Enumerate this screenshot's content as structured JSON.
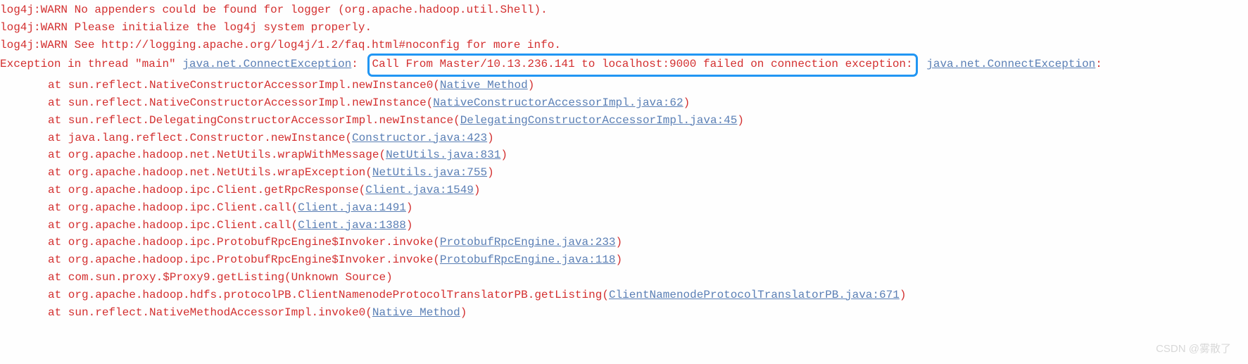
{
  "warn1": "log4j:WARN No appenders could be found for logger (org.apache.hadoop.util.Shell).",
  "warn2": "log4j:WARN Please initialize the log4j system properly.",
  "warn3": "log4j:WARN See http://logging.apache.org/log4j/1.2/faq.html#noconfig for more info.",
  "exception": {
    "prefix": "Exception in thread \"main\" ",
    "class1": "java.net.ConnectException",
    "colon": ": ",
    "highlighted": "Call From Master/10.13.236.141 to localhost:9000 failed on connection exception:",
    "space": " ",
    "class2": "java.net.ConnectException",
    "suffix": ":"
  },
  "stack": [
    {
      "at": "at sun.reflect.NativeConstructorAccessorImpl.newInstance0(",
      "link": "Native Method",
      "close": ")"
    },
    {
      "at": "at sun.reflect.NativeConstructorAccessorImpl.newInstance(",
      "link": "NativeConstructorAccessorImpl.java:62",
      "close": ")"
    },
    {
      "at": "at sun.reflect.DelegatingConstructorAccessorImpl.newInstance(",
      "link": "DelegatingConstructorAccessorImpl.java:45",
      "close": ")"
    },
    {
      "at": "at java.lang.reflect.Constructor.newInstance(",
      "link": "Constructor.java:423",
      "close": ")"
    },
    {
      "at": "at org.apache.hadoop.net.NetUtils.wrapWithMessage(",
      "link": "NetUtils.java:831",
      "close": ")"
    },
    {
      "at": "at org.apache.hadoop.net.NetUtils.wrapException(",
      "link": "NetUtils.java:755",
      "close": ")"
    },
    {
      "at": "at org.apache.hadoop.ipc.Client.getRpcResponse(",
      "link": "Client.java:1549",
      "close": ")"
    },
    {
      "at": "at org.apache.hadoop.ipc.Client.call(",
      "link": "Client.java:1491",
      "close": ")"
    },
    {
      "at": "at org.apache.hadoop.ipc.Client.call(",
      "link": "Client.java:1388",
      "close": ")"
    },
    {
      "at": "at org.apache.hadoop.ipc.ProtobufRpcEngine$Invoker.invoke(",
      "link": "ProtobufRpcEngine.java:233",
      "close": ")"
    },
    {
      "at": "at org.apache.hadoop.ipc.ProtobufRpcEngine$Invoker.invoke(",
      "link": "ProtobufRpcEngine.java:118",
      "close": ")"
    },
    {
      "at": "at com.sun.proxy.$Proxy9.getListing(Unknown Source)",
      "link": "",
      "close": ""
    },
    {
      "at": "at org.apache.hadoop.hdfs.protocolPB.ClientNamenodeProtocolTranslatorPB.getListing(",
      "link": "ClientNamenodeProtocolTranslatorPB.java:671",
      "close": ")"
    },
    {
      "at": "at sun.reflect.NativeMethodAccessorImpl.invoke0(",
      "link": "Native Method",
      "close": ")"
    }
  ],
  "watermark": "CSDN @雾散了"
}
